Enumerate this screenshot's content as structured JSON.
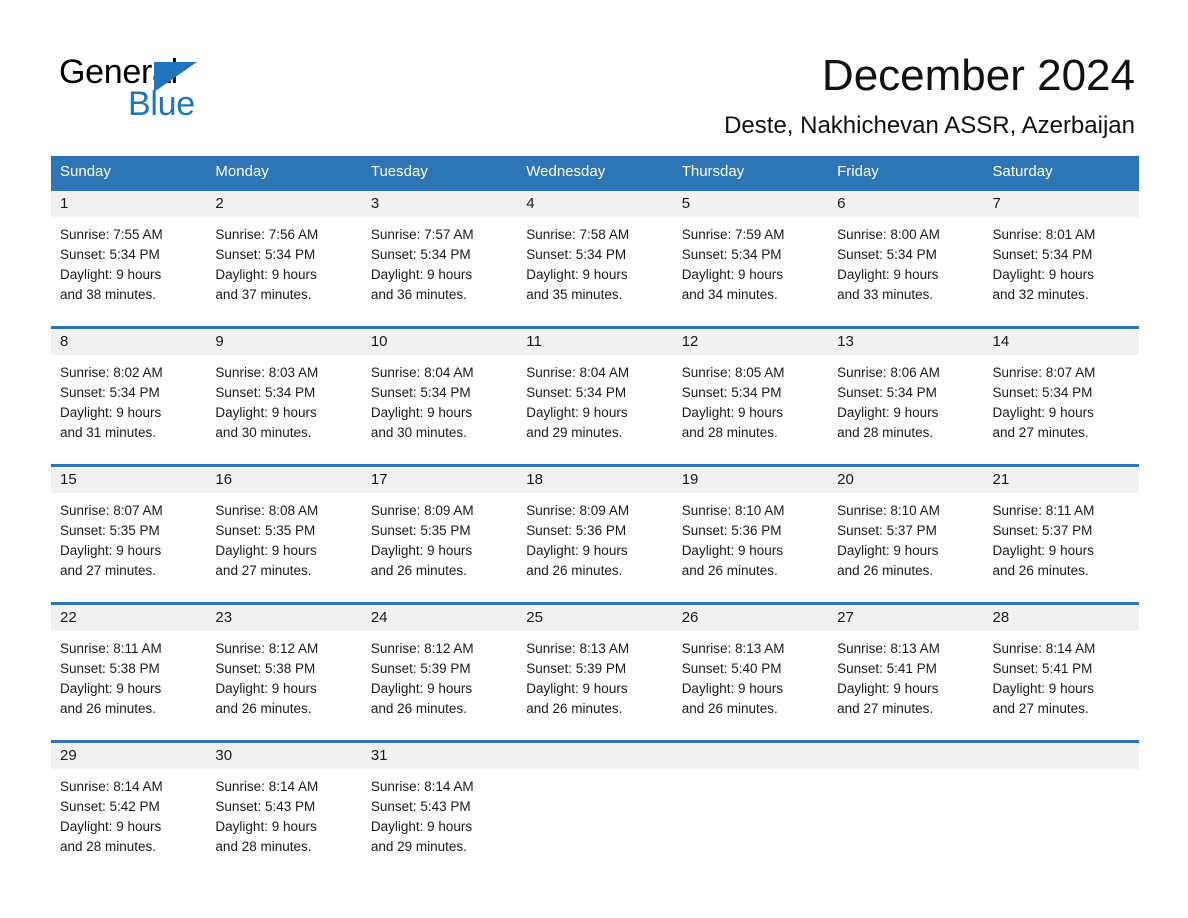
{
  "brand": {
    "name_top": "General",
    "name_bottom": "Blue",
    "accent_color": "#1f76bc"
  },
  "header": {
    "title": "December 2024",
    "subtitle": "Deste, Nakhichevan ASSR, Azerbaijan"
  },
  "theme": {
    "header_blue": "#2e75b6",
    "row_divider_blue": "#2e75b6",
    "date_strip_gray": "#f1f1f1",
    "text_color": "#1a1a1a"
  },
  "weekday_headers": [
    "Sunday",
    "Monday",
    "Tuesday",
    "Wednesday",
    "Thursday",
    "Friday",
    "Saturday"
  ],
  "weeks": [
    [
      {
        "day": "1",
        "l1": "Sunrise: 7:55 AM",
        "l2": "Sunset: 5:34 PM",
        "l3": "Daylight: 9 hours",
        "l4": "and 38 minutes."
      },
      {
        "day": "2",
        "l1": "Sunrise: 7:56 AM",
        "l2": "Sunset: 5:34 PM",
        "l3": "Daylight: 9 hours",
        "l4": "and 37 minutes."
      },
      {
        "day": "3",
        "l1": "Sunrise: 7:57 AM",
        "l2": "Sunset: 5:34 PM",
        "l3": "Daylight: 9 hours",
        "l4": "and 36 minutes."
      },
      {
        "day": "4",
        "l1": "Sunrise: 7:58 AM",
        "l2": "Sunset: 5:34 PM",
        "l3": "Daylight: 9 hours",
        "l4": "and 35 minutes."
      },
      {
        "day": "5",
        "l1": "Sunrise: 7:59 AM",
        "l2": "Sunset: 5:34 PM",
        "l3": "Daylight: 9 hours",
        "l4": "and 34 minutes."
      },
      {
        "day": "6",
        "l1": "Sunrise: 8:00 AM",
        "l2": "Sunset: 5:34 PM",
        "l3": "Daylight: 9 hours",
        "l4": "and 33 minutes."
      },
      {
        "day": "7",
        "l1": "Sunrise: 8:01 AM",
        "l2": "Sunset: 5:34 PM",
        "l3": "Daylight: 9 hours",
        "l4": "and 32 minutes."
      }
    ],
    [
      {
        "day": "8",
        "l1": "Sunrise: 8:02 AM",
        "l2": "Sunset: 5:34 PM",
        "l3": "Daylight: 9 hours",
        "l4": "and 31 minutes."
      },
      {
        "day": "9",
        "l1": "Sunrise: 8:03 AM",
        "l2": "Sunset: 5:34 PM",
        "l3": "Daylight: 9 hours",
        "l4": "and 30 minutes."
      },
      {
        "day": "10",
        "l1": "Sunrise: 8:04 AM",
        "l2": "Sunset: 5:34 PM",
        "l3": "Daylight: 9 hours",
        "l4": "and 30 minutes."
      },
      {
        "day": "11",
        "l1": "Sunrise: 8:04 AM",
        "l2": "Sunset: 5:34 PM",
        "l3": "Daylight: 9 hours",
        "l4": "and 29 minutes."
      },
      {
        "day": "12",
        "l1": "Sunrise: 8:05 AM",
        "l2": "Sunset: 5:34 PM",
        "l3": "Daylight: 9 hours",
        "l4": "and 28 minutes."
      },
      {
        "day": "13",
        "l1": "Sunrise: 8:06 AM",
        "l2": "Sunset: 5:34 PM",
        "l3": "Daylight: 9 hours",
        "l4": "and 28 minutes."
      },
      {
        "day": "14",
        "l1": "Sunrise: 8:07 AM",
        "l2": "Sunset: 5:34 PM",
        "l3": "Daylight: 9 hours",
        "l4": "and 27 minutes."
      }
    ],
    [
      {
        "day": "15",
        "l1": "Sunrise: 8:07 AM",
        "l2": "Sunset: 5:35 PM",
        "l3": "Daylight: 9 hours",
        "l4": "and 27 minutes."
      },
      {
        "day": "16",
        "l1": "Sunrise: 8:08 AM",
        "l2": "Sunset: 5:35 PM",
        "l3": "Daylight: 9 hours",
        "l4": "and 27 minutes."
      },
      {
        "day": "17",
        "l1": "Sunrise: 8:09 AM",
        "l2": "Sunset: 5:35 PM",
        "l3": "Daylight: 9 hours",
        "l4": "and 26 minutes."
      },
      {
        "day": "18",
        "l1": "Sunrise: 8:09 AM",
        "l2": "Sunset: 5:36 PM",
        "l3": "Daylight: 9 hours",
        "l4": "and 26 minutes."
      },
      {
        "day": "19",
        "l1": "Sunrise: 8:10 AM",
        "l2": "Sunset: 5:36 PM",
        "l3": "Daylight: 9 hours",
        "l4": "and 26 minutes."
      },
      {
        "day": "20",
        "l1": "Sunrise: 8:10 AM",
        "l2": "Sunset: 5:37 PM",
        "l3": "Daylight: 9 hours",
        "l4": "and 26 minutes."
      },
      {
        "day": "21",
        "l1": "Sunrise: 8:11 AM",
        "l2": "Sunset: 5:37 PM",
        "l3": "Daylight: 9 hours",
        "l4": "and 26 minutes."
      }
    ],
    [
      {
        "day": "22",
        "l1": "Sunrise: 8:11 AM",
        "l2": "Sunset: 5:38 PM",
        "l3": "Daylight: 9 hours",
        "l4": "and 26 minutes."
      },
      {
        "day": "23",
        "l1": "Sunrise: 8:12 AM",
        "l2": "Sunset: 5:38 PM",
        "l3": "Daylight: 9 hours",
        "l4": "and 26 minutes."
      },
      {
        "day": "24",
        "l1": "Sunrise: 8:12 AM",
        "l2": "Sunset: 5:39 PM",
        "l3": "Daylight: 9 hours",
        "l4": "and 26 minutes."
      },
      {
        "day": "25",
        "l1": "Sunrise: 8:13 AM",
        "l2": "Sunset: 5:39 PM",
        "l3": "Daylight: 9 hours",
        "l4": "and 26 minutes."
      },
      {
        "day": "26",
        "l1": "Sunrise: 8:13 AM",
        "l2": "Sunset: 5:40 PM",
        "l3": "Daylight: 9 hours",
        "l4": "and 26 minutes."
      },
      {
        "day": "27",
        "l1": "Sunrise: 8:13 AM",
        "l2": "Sunset: 5:41 PM",
        "l3": "Daylight: 9 hours",
        "l4": "and 27 minutes."
      },
      {
        "day": "28",
        "l1": "Sunrise: 8:14 AM",
        "l2": "Sunset: 5:41 PM",
        "l3": "Daylight: 9 hours",
        "l4": "and 27 minutes."
      }
    ],
    [
      {
        "day": "29",
        "l1": "Sunrise: 8:14 AM",
        "l2": "Sunset: 5:42 PM",
        "l3": "Daylight: 9 hours",
        "l4": "and 28 minutes."
      },
      {
        "day": "30",
        "l1": "Sunrise: 8:14 AM",
        "l2": "Sunset: 5:43 PM",
        "l3": "Daylight: 9 hours",
        "l4": "and 28 minutes."
      },
      {
        "day": "31",
        "l1": "Sunrise: 8:14 AM",
        "l2": "Sunset: 5:43 PM",
        "l3": "Daylight: 9 hours",
        "l4": "and 29 minutes."
      },
      {
        "day": "",
        "l1": "",
        "l2": "",
        "l3": "",
        "l4": ""
      },
      {
        "day": "",
        "l1": "",
        "l2": "",
        "l3": "",
        "l4": ""
      },
      {
        "day": "",
        "l1": "",
        "l2": "",
        "l3": "",
        "l4": ""
      },
      {
        "day": "",
        "l1": "",
        "l2": "",
        "l3": "",
        "l4": ""
      }
    ]
  ]
}
